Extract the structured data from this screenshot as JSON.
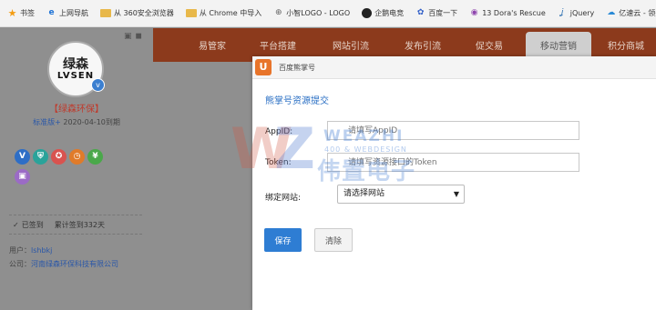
{
  "bookmarks": [
    {
      "icon": "star-icon",
      "label": "书签"
    },
    {
      "icon": "ie-icon",
      "label": "上网导航"
    },
    {
      "icon": "folder-icon",
      "label": "从 360安全浏览器"
    },
    {
      "icon": "folder-icon",
      "label": "从 Chrome 中导入"
    },
    {
      "icon": "globe-icon",
      "label": "小智LOGO - LOGO"
    },
    {
      "icon": "site-icon",
      "label": "企鹅电竞"
    },
    {
      "icon": "baidu-icon",
      "label": "百度一下"
    },
    {
      "icon": "ring-icon",
      "label": "13 Dora's Rescue"
    },
    {
      "icon": "jquery-icon",
      "label": "jQuery"
    },
    {
      "icon": "cloud-icon",
      "label": "亿速云 - 领先的"
    }
  ],
  "sidebar": {
    "logo_cn": "绿森",
    "logo_en": "LVSEN",
    "company": "【绿森环保】",
    "plan": "标准版+",
    "expiry": "2020-04-10到期",
    "badges": [
      {
        "icon": "v-badge-icon",
        "text": "V",
        "color": "#2e6ec6"
      },
      {
        "icon": "shield-badge-icon",
        "text": "⛨",
        "color": "#2aa39a"
      },
      {
        "icon": "award-badge-icon",
        "text": "✪",
        "color": "#d9534f"
      },
      {
        "icon": "clock-badge-icon",
        "text": "◷",
        "color": "#e07b2a"
      },
      {
        "icon": "yen-badge-icon",
        "text": "¥",
        "color": "#4aa84a"
      },
      {
        "icon": "image-badge-icon",
        "text": "▣",
        "color": "#9b6bc6"
      }
    ],
    "signed": "已签到",
    "total_signin": "累计签到332天",
    "user_label": "用户：",
    "user_value": "lshbkj",
    "company_label": "公司：",
    "company_value": "河南绿森环保科技有限公司"
  },
  "nav": {
    "items": [
      "易管家",
      "平台搭建",
      "网站引流",
      "发布引流",
      "促交易"
    ],
    "active": "移动营销",
    "last": "积分商城"
  },
  "modal": {
    "header": "百度熊掌号",
    "section_title": "熊掌号资源提交",
    "appid_label": "AppID:",
    "appid_placeholder": "请填写AppID",
    "token_label": "Token:",
    "token_placeholder": "请填写资源接口的Token",
    "site_label": "绑定网站:",
    "site_select": "请选择网站",
    "save": "保存",
    "clear": "清除"
  },
  "watermark": {
    "en": "WEAZHI",
    "sub": "400 & WEBDESIGN",
    "cn": "伟置电子"
  }
}
